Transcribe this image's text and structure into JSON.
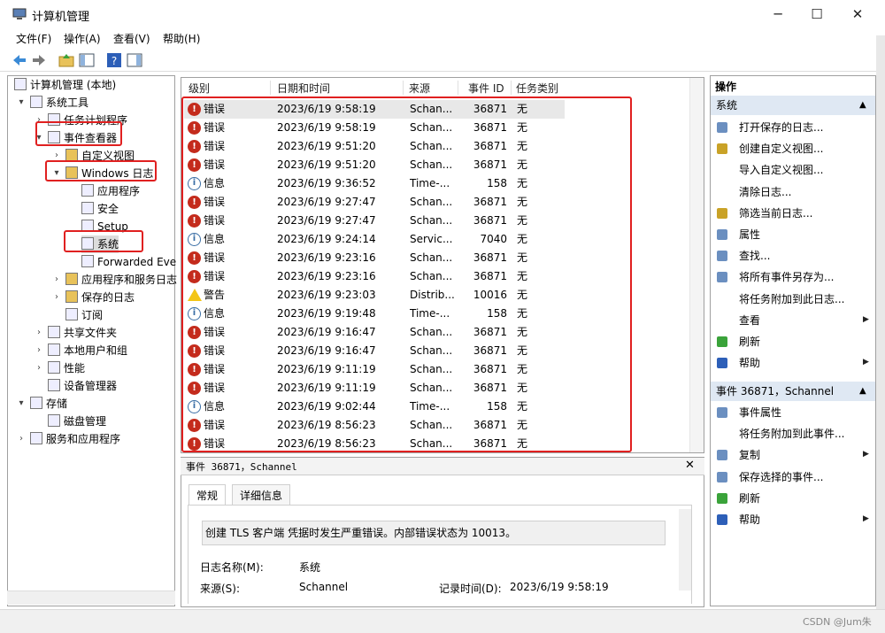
{
  "window": {
    "title": "计算机管理",
    "minimize": "─",
    "maximize": "☐",
    "close": "✕"
  },
  "menu": [
    "文件(F)",
    "操作(A)",
    "查看(V)",
    "帮助(H)"
  ],
  "tree": {
    "root": "计算机管理 (本地)",
    "system_tools": "系统工具",
    "task_scheduler": "任务计划程序",
    "event_viewer": "事件查看器",
    "custom_views": "自定义视图",
    "windows_logs": "Windows 日志",
    "application": "应用程序",
    "security": "安全",
    "setup": "Setup",
    "system": "系统",
    "forwarded": "Forwarded Eve",
    "app_service_logs": "应用程序和服务日志",
    "saved_logs": "保存的日志",
    "subscriptions": "订阅",
    "shared_folders": "共享文件夹",
    "local_users": "本地用户和组",
    "performance": "性能",
    "device_manager": "设备管理器",
    "storage": "存储",
    "disk_management": "磁盘管理",
    "services_apps": "服务和应用程序"
  },
  "list": {
    "columns": [
      "级别",
      "日期和时间",
      "来源",
      "事件 ID",
      "任务类别"
    ],
    "rows": [
      {
        "level": "错误",
        "type": "error",
        "time": "2023/6/19 9:58:19",
        "source": "Schan...",
        "id": "36871",
        "cat": "无"
      },
      {
        "level": "错误",
        "type": "error",
        "time": "2023/6/19 9:58:19",
        "source": "Schan...",
        "id": "36871",
        "cat": "无"
      },
      {
        "level": "错误",
        "type": "error",
        "time": "2023/6/19 9:51:20",
        "source": "Schan...",
        "id": "36871",
        "cat": "无"
      },
      {
        "level": "错误",
        "type": "error",
        "time": "2023/6/19 9:51:20",
        "source": "Schan...",
        "id": "36871",
        "cat": "无"
      },
      {
        "level": "信息",
        "type": "info",
        "time": "2023/6/19 9:36:52",
        "source": "Time-...",
        "id": "158",
        "cat": "无"
      },
      {
        "level": "错误",
        "type": "error",
        "time": "2023/6/19 9:27:47",
        "source": "Schan...",
        "id": "36871",
        "cat": "无"
      },
      {
        "level": "错误",
        "type": "error",
        "time": "2023/6/19 9:27:47",
        "source": "Schan...",
        "id": "36871",
        "cat": "无"
      },
      {
        "level": "信息",
        "type": "info",
        "time": "2023/6/19 9:24:14",
        "source": "Servic...",
        "id": "7040",
        "cat": "无"
      },
      {
        "level": "错误",
        "type": "error",
        "time": "2023/6/19 9:23:16",
        "source": "Schan...",
        "id": "36871",
        "cat": "无"
      },
      {
        "level": "错误",
        "type": "error",
        "time": "2023/6/19 9:23:16",
        "source": "Schan...",
        "id": "36871",
        "cat": "无"
      },
      {
        "level": "警告",
        "type": "warn",
        "time": "2023/6/19 9:23:03",
        "source": "Distrib...",
        "id": "10016",
        "cat": "无"
      },
      {
        "level": "信息",
        "type": "info",
        "time": "2023/6/19 9:19:48",
        "source": "Time-...",
        "id": "158",
        "cat": "无"
      },
      {
        "level": "错误",
        "type": "error",
        "time": "2023/6/19 9:16:47",
        "source": "Schan...",
        "id": "36871",
        "cat": "无"
      },
      {
        "level": "错误",
        "type": "error",
        "time": "2023/6/19 9:16:47",
        "source": "Schan...",
        "id": "36871",
        "cat": "无"
      },
      {
        "level": "错误",
        "type": "error",
        "time": "2023/6/19 9:11:19",
        "source": "Schan...",
        "id": "36871",
        "cat": "无"
      },
      {
        "level": "错误",
        "type": "error",
        "time": "2023/6/19 9:11:19",
        "source": "Schan...",
        "id": "36871",
        "cat": "无"
      },
      {
        "level": "信息",
        "type": "info",
        "time": "2023/6/19 9:02:44",
        "source": "Time-...",
        "id": "158",
        "cat": "无"
      },
      {
        "level": "错误",
        "type": "error",
        "time": "2023/6/19 8:56:23",
        "source": "Schan...",
        "id": "36871",
        "cat": "无"
      },
      {
        "level": "错误",
        "type": "error",
        "time": "2023/6/19 8:56:23",
        "source": "Schan...",
        "id": "36871",
        "cat": "无"
      }
    ]
  },
  "detail": {
    "title": "事件 36871，Schannel",
    "tab_general": "常规",
    "tab_details": "详细信息",
    "description": "创建 TLS 客户端 凭据时发生严重错误。内部错误状态为 10013。",
    "log_name_label": "日志名称(M):",
    "log_name_value": "系统",
    "source_label": "来源(S):",
    "source_value": "Schannel",
    "logged_label": "记录时间(D):",
    "logged_value": "2023/6/19 9:58:19"
  },
  "actions": {
    "title": "操作",
    "section1": "系统",
    "items1": [
      "打开保存的日志...",
      "创建自定义视图...",
      "导入自定义视图...",
      "清除日志...",
      "筛选当前日志...",
      "属性",
      "查找...",
      "将所有事件另存为...",
      "将任务附加到此日志...",
      "查看",
      "刷新",
      "帮助"
    ],
    "section2": "事件 36871，Schannel",
    "items2": [
      "事件属性",
      "将任务附加到此事件...",
      "复制",
      "保存选择的事件...",
      "刷新",
      "帮助"
    ]
  },
  "watermark": "CSDN @Jum朱",
  "colors": {
    "highlight": "#e02020",
    "error": "#c42b1c",
    "info": "#3a6ea5",
    "warning": "#f3c516",
    "action_header": "#dfe8f3"
  }
}
